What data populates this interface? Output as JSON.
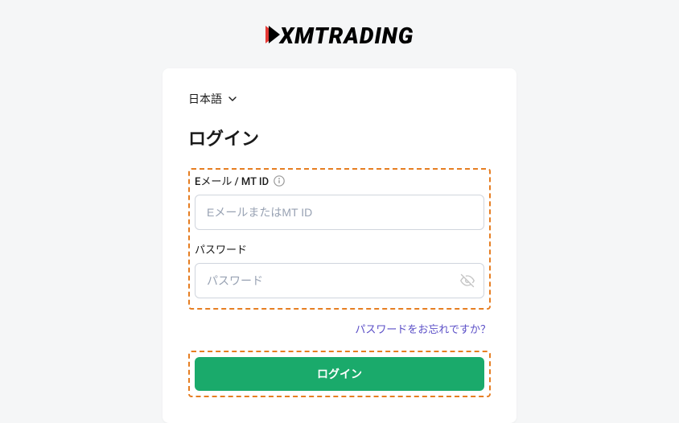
{
  "brand": {
    "name": "XMTRADING"
  },
  "language": {
    "current": "日本語"
  },
  "heading": "ログイン",
  "fields": {
    "email": {
      "label": "Eメール / MT ID",
      "placeholder": "EメールまたはMT ID"
    },
    "password": {
      "label": "パスワード",
      "placeholder": "パスワード"
    }
  },
  "links": {
    "forgot": "パスワードをお忘れですか？"
  },
  "buttons": {
    "login": "ログイン"
  }
}
